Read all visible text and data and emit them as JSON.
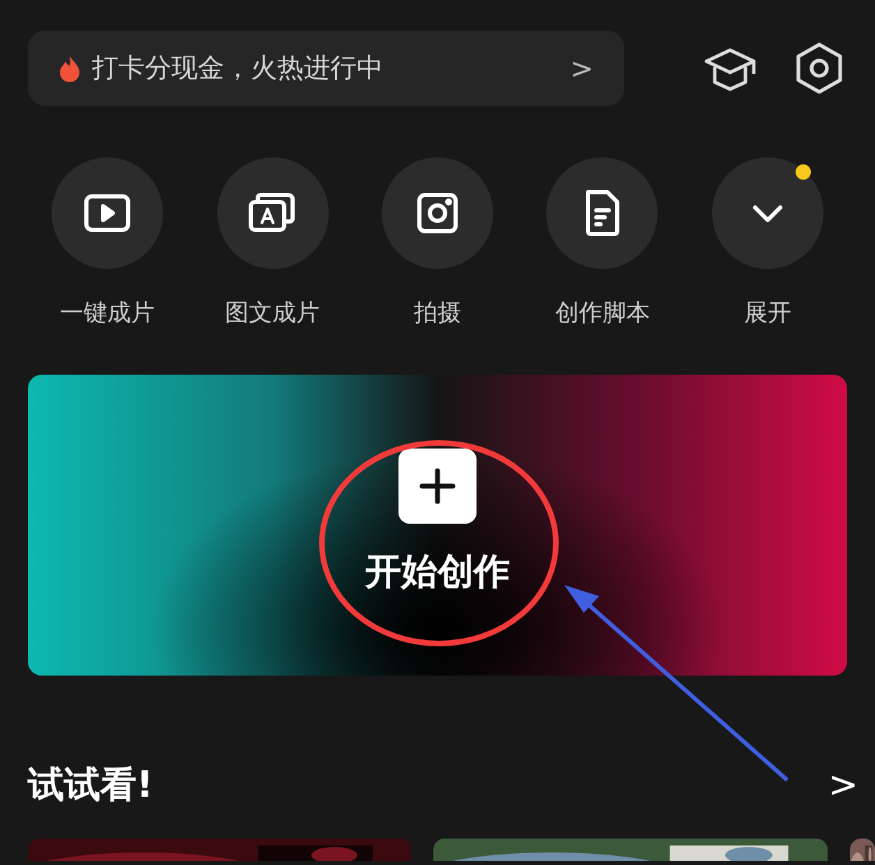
{
  "promo_banner": {
    "text": "打卡分现金，火热进行中",
    "chevron": ">"
  },
  "quick_actions": [
    {
      "kind": "video",
      "label": "一键成片",
      "badge": false
    },
    {
      "kind": "text",
      "label": "图文成片",
      "badge": false
    },
    {
      "kind": "camera",
      "label": "拍摄",
      "badge": false
    },
    {
      "kind": "script",
      "label": "创作脚本",
      "badge": false
    },
    {
      "kind": "expand",
      "label": "展开",
      "badge": true
    }
  ],
  "create_card": {
    "label": "开始创作"
  },
  "try_section": {
    "title": "试试看!",
    "chevron": ">"
  }
}
